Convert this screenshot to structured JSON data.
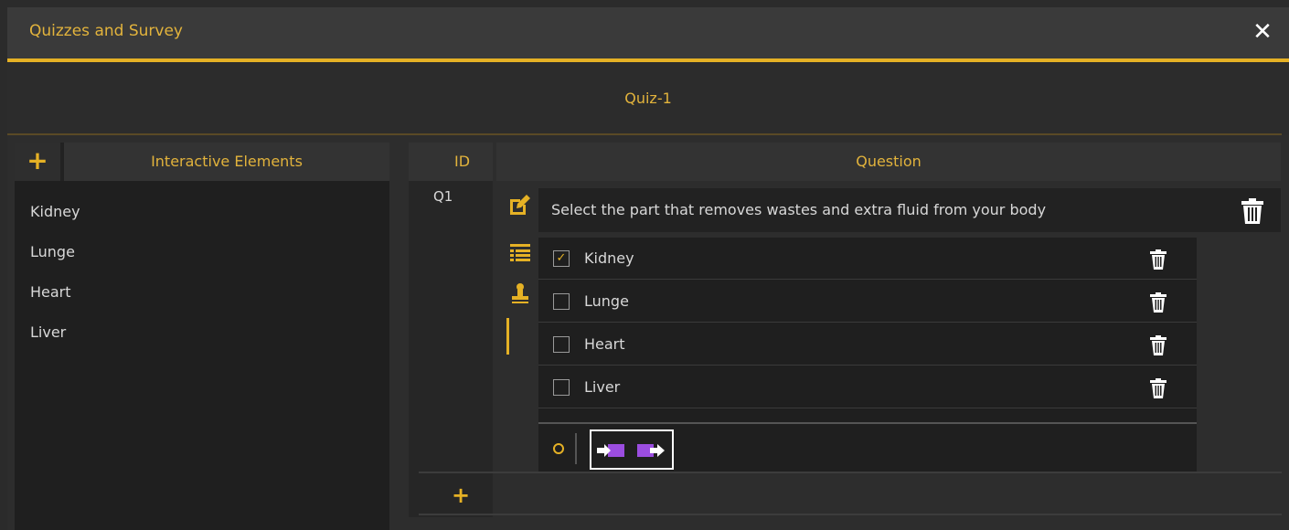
{
  "window": {
    "title": "Quizzes and Survey",
    "close_label": "✕"
  },
  "quiz": {
    "title": "Quiz-1"
  },
  "elements_panel": {
    "add_label": "+",
    "title": "Interactive Elements",
    "items": [
      "Kidney",
      "Lunge",
      "Heart",
      "Liver"
    ]
  },
  "questions_table": {
    "id_header": "ID",
    "question_header": "Question",
    "add_label": "+"
  },
  "question": {
    "id": "Q1",
    "text": "Select the part that removes wastes and extra fluid from your body",
    "answers": [
      {
        "label": "Kidney",
        "checked": true,
        "check_mark": "✓"
      },
      {
        "label": "Lunge",
        "checked": false,
        "check_mark": ""
      },
      {
        "label": "Heart",
        "checked": false,
        "check_mark": ""
      },
      {
        "label": "Liver",
        "checked": false,
        "check_mark": ""
      }
    ]
  },
  "icons": {
    "edit": "edit-icon",
    "list": "list-icon",
    "stamp": "stamp-icon",
    "trash": "trash-icon",
    "transfer_in": "transfer-in-icon",
    "transfer_out": "transfer-out-icon"
  },
  "colors": {
    "accent": "#e5b125",
    "text": "#d8d8d8",
    "transfer_purple": "#9b4de0"
  }
}
